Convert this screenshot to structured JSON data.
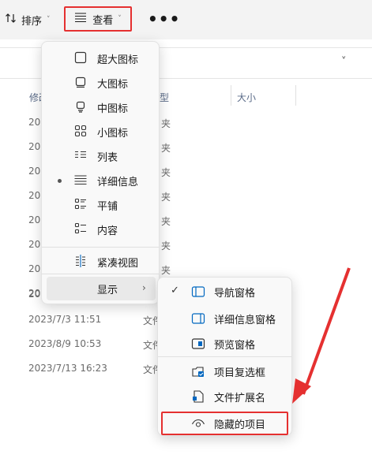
{
  "toolbar": {
    "sort_label": "排序",
    "view_label": "查看",
    "more_label": "•••"
  },
  "columns": [
    "修改日期",
    "类型",
    "大小"
  ],
  "rows": [
    {
      "date": "2023",
      "type": "夹"
    },
    {
      "date": "2023",
      "type": "夹"
    },
    {
      "date": "2023",
      "type": "夹"
    },
    {
      "date": "2023",
      "type": "夹"
    },
    {
      "date": "2023",
      "type": "夹"
    },
    {
      "date": "2023",
      "type": "夹"
    },
    {
      "date": "2023",
      "type": "夹"
    },
    {
      "date": "2023",
      "type": "夹"
    },
    {
      "date": "2023",
      "type": ""
    },
    {
      "date": "2023/7/3 11:51",
      "type": "文件"
    },
    {
      "date": "2023/8/9 10:53",
      "type": "文件"
    },
    {
      "date": "2023/7/13 16:23",
      "type": "文件"
    }
  ],
  "view_menu": {
    "items": [
      {
        "label": "超大图标",
        "icon": "extra-large-icons-icon"
      },
      {
        "label": "大图标",
        "icon": "large-icons-icon"
      },
      {
        "label": "中图标",
        "icon": "medium-icons-icon"
      },
      {
        "label": "小图标",
        "icon": "small-icons-icon"
      },
      {
        "label": "列表",
        "icon": "list-icon"
      },
      {
        "label": "详细信息",
        "icon": "details-icon",
        "selected": true
      },
      {
        "label": "平铺",
        "icon": "tiles-icon"
      },
      {
        "label": "内容",
        "icon": "content-icon"
      },
      {
        "label": "紧凑视图",
        "icon": "compact-view-icon"
      },
      {
        "label": "显示",
        "submenu": true
      }
    ]
  },
  "show_menu": {
    "items": [
      {
        "label": "导航窗格",
        "checked": true,
        "icon": "navigation-pane-icon"
      },
      {
        "label": "详细信息窗格",
        "icon": "details-pane-icon"
      },
      {
        "label": "预览窗格",
        "icon": "preview-pane-icon"
      },
      {
        "label": "项目复选框",
        "icon": "item-checkbox-icon"
      },
      {
        "label": "文件扩展名",
        "icon": "file-extension-icon"
      },
      {
        "label": "隐藏的项目",
        "icon": "hidden-items-icon",
        "highlighted": true
      }
    ]
  },
  "colors": {
    "highlight_border": "#e53030",
    "arrow": "#e53030",
    "accent": "#0067c0"
  }
}
